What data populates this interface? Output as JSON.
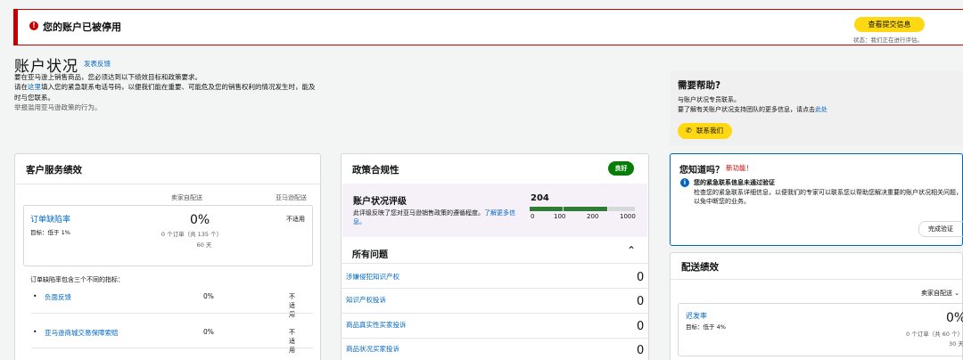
{
  "alert": {
    "icon": "error-exclamation-icon",
    "title": "您的账户已被停用",
    "button": "查看提交信息",
    "status": "状态：我们正在进行评估。"
  },
  "header": {
    "title": "账户状况",
    "feedback_link": "发表反馈",
    "line1": "要在亚马逊上销售商品，您必须达到以下绩效目标和政策要求。",
    "line2_prefix": "请在",
    "line2_link": "这里",
    "line2_suffix": "填入您的紧急联系电话号码，以便我们能在重要、可能危及您的销售权利的情况发生时，能及时与您联系。",
    "line3": "举报滥用亚马逊政策的行为。"
  },
  "help": {
    "title": "需要帮助?",
    "line1": "与账户状况专员联系。",
    "line2_prefix": "要了解有关账户状况支持团队的更多信息，请点击",
    "line2_link": "此处",
    "button": "联系我们",
    "button_icon": "phone-icon"
  },
  "customer_service": {
    "title": "客户服务绩效",
    "col_merchant": "卖家自配送",
    "col_amazon": "亚马逊配送",
    "odr": {
      "name": "订单缺陷率",
      "target": "目标：低于 1%",
      "percent": "0%",
      "orders": "0 个订单（共 135 个）",
      "days": "60 天",
      "amazon_value": "不适用"
    },
    "intro": "订单缺陷率包含三个不同的指标：",
    "sub_metrics": [
      {
        "name": "负面反馈",
        "percent": "0%",
        "amazon_value": "不适用"
      },
      {
        "name": "亚马逊商城交易保障索赔",
        "percent": "0%",
        "amazon_value": "不适用"
      }
    ]
  },
  "policy": {
    "title": "政策合规性",
    "badge": "良好",
    "badge_color": "#067d06",
    "ahr": {
      "title": "账户状况评级",
      "desc_prefix": "此评级反映了您对亚马逊销售政策的遵循程度。",
      "desc_link": "了解更多信息。",
      "score": "204",
      "score_value": 204,
      "bar_colors": [
        "#2e7d32",
        "#2e7d32",
        "#d5d9d9"
      ],
      "ticks": [
        "0",
        "100",
        "200",
        "1000"
      ]
    },
    "all_issues_title": "所有问题",
    "issues": [
      {
        "name": "涉嫌侵犯知识产权",
        "count": "0"
      },
      {
        "name": "知识产权投诉",
        "count": "0"
      },
      {
        "name": "商品真实性买家投诉",
        "count": "0"
      },
      {
        "name": "商品状况买家投诉",
        "count": "0"
      }
    ]
  },
  "did_you_know": {
    "title": "您知道吗？",
    "new_label": "新功能！",
    "bold_line": "您的紧急联系信息未通过验证",
    "description": "检查您的紧急联系详细信息，以便我们的专家可以联系您以帮助您解决重要的账户状况相关问题，以免中断您的业务。",
    "button": "完成验证",
    "icon": "info-icon"
  },
  "shipping": {
    "title": "配送绩效",
    "dropdown": "卖家自配送",
    "metric": {
      "name": "迟发率",
      "target": "目标：低于 4%",
      "percent": "0%",
      "orders": "0 个订单（共 60 个）",
      "days": "30 天"
    }
  }
}
